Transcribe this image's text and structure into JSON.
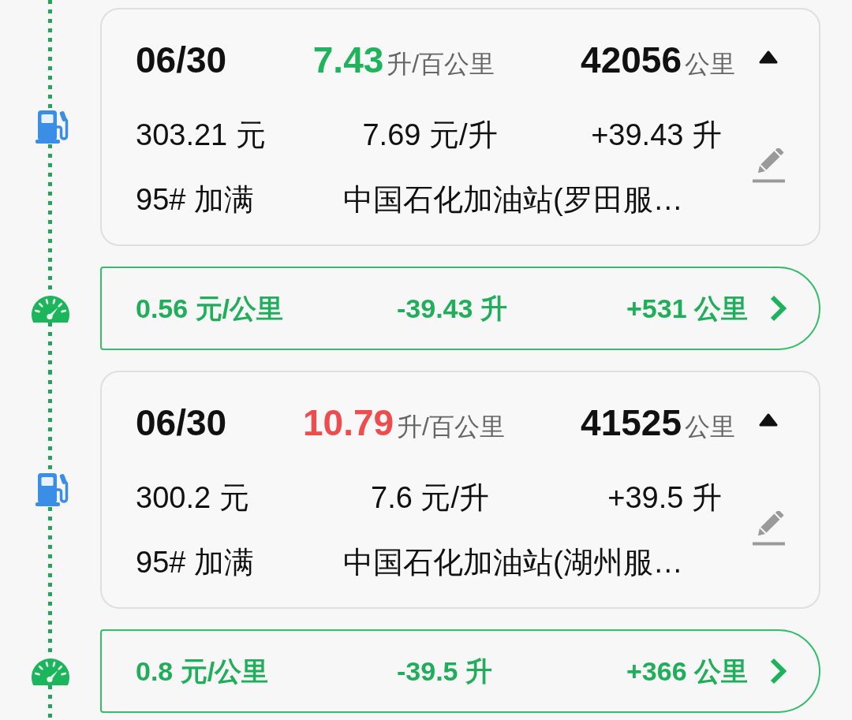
{
  "entries": [
    {
      "kind": "refuel",
      "date": "06/30",
      "consumption": {
        "value": "7.43",
        "unit": "升/百公里",
        "color": "#1fb45c"
      },
      "odometer": {
        "value": "42056",
        "unit": "公里"
      },
      "expanded": true,
      "amount": "303.21 元",
      "unit_price": "7.69 元/升",
      "volume": "+39.43 升",
      "fuel_grade": "95# 加满",
      "station": "中国石化加油站(罗田服…"
    },
    {
      "kind": "summary",
      "cost_per_km": "0.56 元/公里",
      "volume_change": "-39.43 升",
      "distance": "+531 公里"
    },
    {
      "kind": "refuel",
      "date": "06/30",
      "consumption": {
        "value": "10.79",
        "unit": "升/百公里",
        "color": "#ef4d4d"
      },
      "odometer": {
        "value": "41525",
        "unit": "公里"
      },
      "expanded": true,
      "amount": "300.2 元",
      "unit_price": "7.6 元/升",
      "volume": "+39.5 升",
      "fuel_grade": "95# 加满",
      "station": "中国石化加油站(湖州服…"
    },
    {
      "kind": "summary",
      "cost_per_km": "0.8 元/公里",
      "volume_change": "-39.5 升",
      "distance": "+366 公里"
    }
  ]
}
